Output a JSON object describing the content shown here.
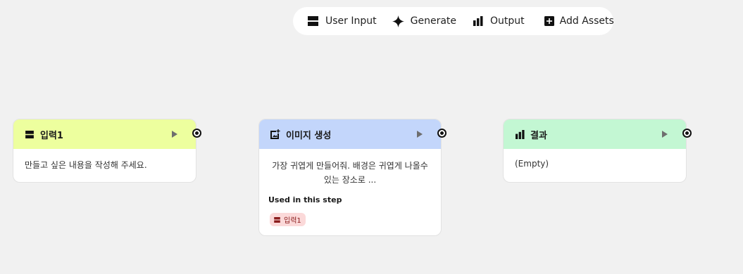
{
  "toolbar": {
    "items": [
      {
        "label": "User Input",
        "icon": "user-input-icon"
      },
      {
        "label": "Generate",
        "icon": "sparkle-icon"
      },
      {
        "label": "Output",
        "icon": "bar-chart-icon"
      },
      {
        "label": "Add Assets",
        "icon": "add-box-icon"
      }
    ]
  },
  "nodes": {
    "input": {
      "title": "입력1",
      "body": "만들고 싶은 내용을 작성해 주세요.",
      "color": "#edff9e",
      "icon": "user-input-icon"
    },
    "generate": {
      "title": "이미지 생성",
      "body_line1": "가장 귀엽게 만들어줘. 배경은 귀엽게 나올수",
      "body_line2": "있는 장소로 ...",
      "used_label": "Used in this step",
      "chip_label": "입력1",
      "color": "#c3d6fb",
      "chip_color": "#fbd9d9",
      "icon": "image-add-icon"
    },
    "output": {
      "title": "결과",
      "body": "(Empty)",
      "color": "#c3f7d3",
      "icon": "bar-chart-icon"
    }
  },
  "colors": {
    "canvas": "#f1f1f1",
    "port": "#111111",
    "play": "#6e6e6e"
  }
}
